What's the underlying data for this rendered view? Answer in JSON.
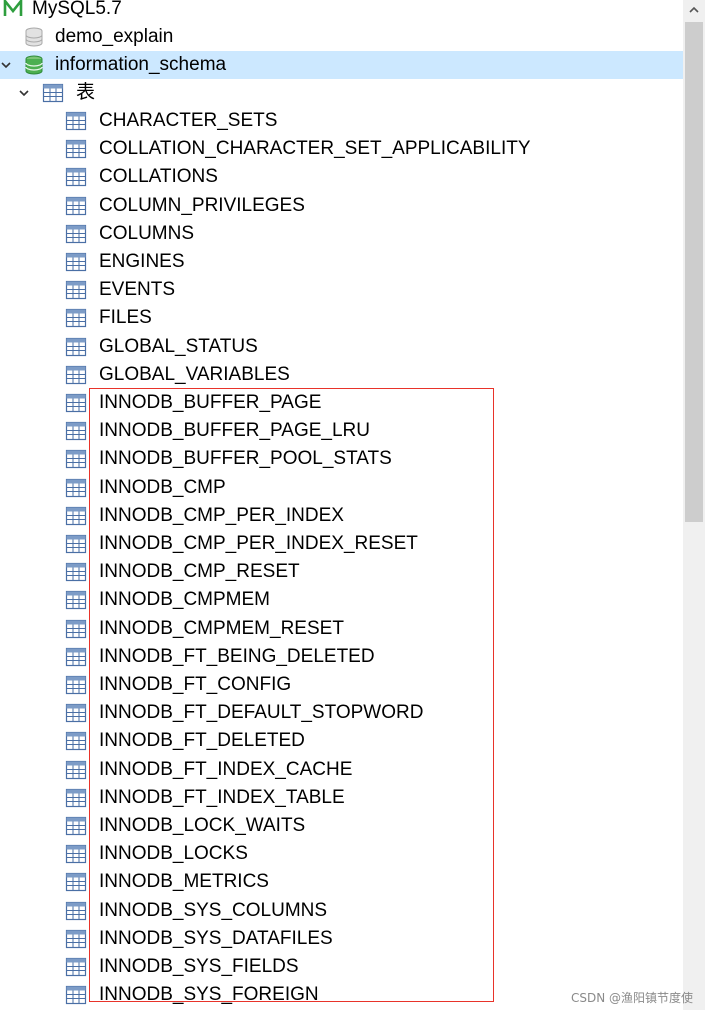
{
  "tree": {
    "connection": {
      "label": "MySQL5.7",
      "icon": "mysql-connection-icon"
    },
    "databases": [
      {
        "label": "demo_explain",
        "icon": "database-icon",
        "expanded": false,
        "selected": false
      },
      {
        "label": "information_schema",
        "icon": "database-open-icon",
        "expanded": true,
        "selected": true
      }
    ],
    "tables_group": {
      "label": "表",
      "icon": "table-group-icon",
      "expanded": true
    },
    "tables": [
      "CHARACTER_SETS",
      "COLLATION_CHARACTER_SET_APPLICABILITY",
      "COLLATIONS",
      "COLUMN_PRIVILEGES",
      "COLUMNS",
      "ENGINES",
      "EVENTS",
      "FILES",
      "GLOBAL_STATUS",
      "GLOBAL_VARIABLES",
      "INNODB_BUFFER_PAGE",
      "INNODB_BUFFER_PAGE_LRU",
      "INNODB_BUFFER_POOL_STATS",
      "INNODB_CMP",
      "INNODB_CMP_PER_INDEX",
      "INNODB_CMP_PER_INDEX_RESET",
      "INNODB_CMP_RESET",
      "INNODB_CMPMEM",
      "INNODB_CMPMEM_RESET",
      "INNODB_FT_BEING_DELETED",
      "INNODB_FT_CONFIG",
      "INNODB_FT_DEFAULT_STOPWORD",
      "INNODB_FT_DELETED",
      "INNODB_FT_INDEX_CACHE",
      "INNODB_FT_INDEX_TABLE",
      "INNODB_LOCK_WAITS",
      "INNODB_LOCKS",
      "INNODB_METRICS",
      "INNODB_SYS_COLUMNS",
      "INNODB_SYS_DATAFILES",
      "INNODB_SYS_FIELDS",
      "INNODB_SYS_FOREIGN"
    ]
  },
  "colors": {
    "selection": "#cce8ff",
    "highlight_box": "#e8332a",
    "database_green": "#4caf50",
    "table_icon_blue": "#4a6fa5"
  },
  "watermark": "CSDN @渔阳镇节度使"
}
